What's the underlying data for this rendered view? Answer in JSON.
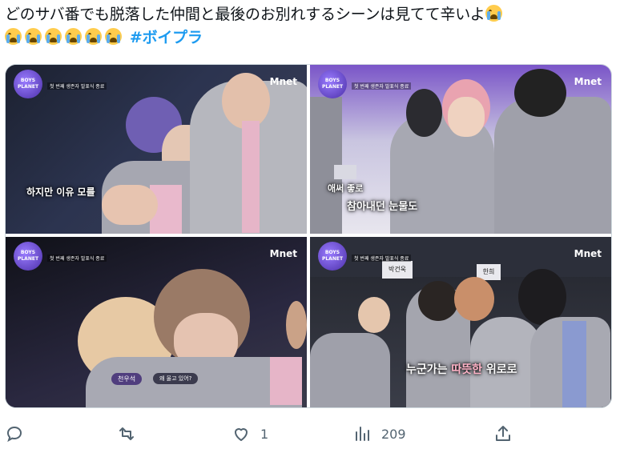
{
  "tweet": {
    "text": "どのサバ番でも脱落した仲間と最後のお別れするシーンは見てて辛いよ",
    "hashtag": "#ボイプラ"
  },
  "media": {
    "logo_text": "BOYS PLANET",
    "logo_caption": "첫 번째 생존자 발표식 종료",
    "network": "Mnet",
    "panel1_subtitle": "하지만 이유 모를",
    "panel2_subtitle_1": "애써 좋로",
    "panel2_subtitle_2": "참아내던 눈물도",
    "panel3_name": "천우석",
    "panel3_chip": "왜 울고 있어?",
    "panel4_nameplate_1": "박건욱",
    "panel4_nameplate_2": "한희",
    "panel4_subtitle_a": "누군가는 ",
    "panel4_subtitle_b": "따뜻한",
    "panel4_subtitle_c": " 위로로"
  },
  "actions": {
    "reply_icon": "reply-icon",
    "retweet_icon": "retweet-icon",
    "like_icon": "like-icon",
    "like_count": "1",
    "views_icon": "views-icon",
    "views_count": "209",
    "share_icon": "share-icon"
  },
  "colors": {
    "hashtag": "#1d9bf0",
    "icon_gray": "#536471",
    "emoji": "#ffcc4d"
  }
}
